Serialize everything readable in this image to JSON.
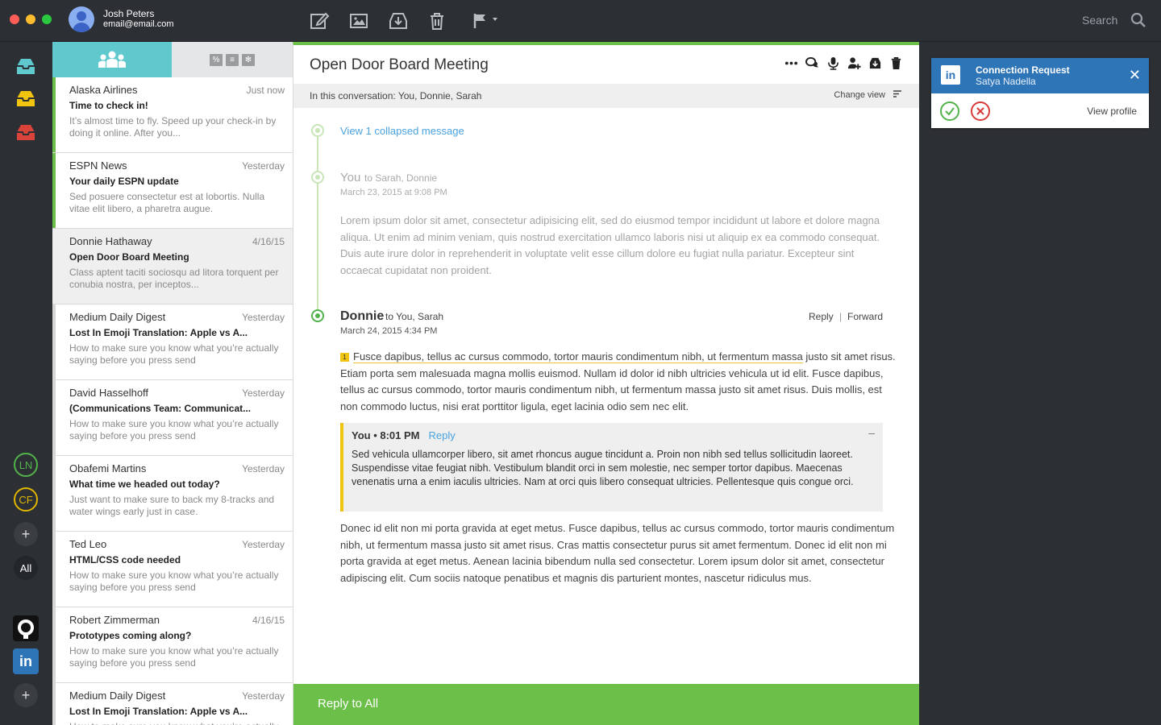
{
  "user": {
    "name": "Josh Peters",
    "email": "email@email.com"
  },
  "search": {
    "label": "Search"
  },
  "accounts": [
    {
      "label": "LN",
      "color": "#52b24b"
    },
    {
      "label": "CF",
      "color": "#e0b500"
    },
    {
      "label": "+"
    },
    {
      "label": "All"
    }
  ],
  "apps": {
    "add_label": "+",
    "linkedin_label": "in"
  },
  "list": {
    "filters": [
      "%",
      "≡",
      "✻"
    ],
    "messages": [
      {
        "sender": "Alaska Airlines",
        "date": "Just now",
        "subject": "Time to check in!",
        "preview": "It’s almost time to fly. Speed up your check-in by doing it online. After you...",
        "state": "unread"
      },
      {
        "sender": "ESPN News",
        "date": "Yesterday",
        "subject": "Your daily ESPN update",
        "preview": "Sed posuere consectetur est at lobortis. Nulla vitae elit libero, a pharetra augue.",
        "state": "unread"
      },
      {
        "sender": "Donnie Hathaway",
        "date": "4/16/15",
        "subject": "Open Door Board Meeting",
        "preview": "Class aptent taciti sociosqu ad litora torquent per conubia nostra, per inceptos...",
        "state": "selected"
      },
      {
        "sender": "Medium Daily Digest",
        "date": "Yesterday",
        "subject": "Lost In Emoji Translation: Apple vs A...",
        "preview": "How to make sure you know what you’re actually saying before you press send",
        "state": "read"
      },
      {
        "sender": "David Hasselhoff",
        "date": "Yesterday",
        "subject": "(Communications Team: Communicat...",
        "preview": "How to make sure you know what you’re actually saying before you press send",
        "state": "read"
      },
      {
        "sender": "Obafemi Martins",
        "date": "Yesterday",
        "subject": "What time we headed out today?",
        "preview": "Just want to make sure to back my 8-tracks and water wings early just in case.",
        "state": "read"
      },
      {
        "sender": "Ted Leo",
        "date": "Yesterday",
        "subject": "HTML/CSS code needed",
        "preview": "How to make sure you know what you’re actually saying before you press send",
        "state": "read"
      },
      {
        "sender": "Robert Zimmerman",
        "date": "4/16/15",
        "subject": "Prototypes coming along?",
        "preview": "How to make sure you know what you’re actually saying before you press send",
        "state": "read"
      },
      {
        "sender": "Medium Daily Digest",
        "date": "Yesterday",
        "subject": "Lost In Emoji Translation: Apple vs A...",
        "preview": "How to make sure you know what you’re actually saying before you press send",
        "state": "read"
      }
    ]
  },
  "conversation": {
    "title": "Open Door Board Meeting",
    "participants": "In this conversation: You, Donnie, Sarah",
    "change_view": "Change view",
    "collapsed_link": "View 1 collapsed message",
    "message1": {
      "from": "You",
      "to": "to Sarah, Donnie",
      "date": "March 23, 2015 at 9:08 PM",
      "body": "Lorem ipsum dolor sit amet, consectetur adipisicing elit, sed do eiusmod tempor incididunt ut labore et dolore magna aliqua. Ut enim ad minim veniam, quis nostrud exercitation ullamco laboris nisi ut aliquip ex ea commodo consequat. Duis aute irure dolor in reprehenderit in voluptate velit esse cillum dolore eu fugiat nulla pariatur. Excepteur sint occaecat cupidatat non proident."
    },
    "message2": {
      "from": "Donnie",
      "to": "to You, Sarah",
      "date": "March 24, 2015 4:34 PM",
      "reply": "Reply",
      "separator": "|",
      "forward": "Forward",
      "note_badge": "1",
      "highlight": "Fusce dapibus, tellus ac cursus commodo, tortor mauris condimentum nibh, ut fermentum massa",
      "body1_rest": " justo sit amet risus. Etiam porta sem malesuada magna mollis euismod. Nullam id dolor id nibh ultricies vehicula ut id elit. Fusce dapibus, tellus ac cursus commodo, tortor mauris condimentum nibh, ut fermentum massa justo sit amet risus. Duis mollis, est non commodo luctus, nisi erat porttitor ligula, eget lacinia odio sem nec elit.",
      "quote": {
        "header": "You • 8:01 PM",
        "reply": "Reply",
        "collapse": "–",
        "body": "Sed vehicula ullamcorper libero, sit amet rhoncus augue tincidunt a. Proin non nibh sed tellus sollicitudin laoreet. Suspendisse vitae feugiat nibh. Vestibulum blandit orci in sem molestie, nec semper tortor dapibus. Maecenas venenatis urna a enim iaculis ultricies. Nam at orci quis libero consequat ultricies. Pellentesque quis congue orci."
      },
      "body2": "Donec id elit non mi porta gravida at eget metus. Fusce dapibus, tellus ac cursus commodo, tortor mauris condimentum nibh, ut fermentum massa justo sit amet risus. Cras mattis consectetur purus sit amet fermentum. Donec id elit non mi porta gravida at eget metus. Aenean lacinia bibendum nulla sed consectetur. Lorem ipsum dolor sit amet, consectetur adipiscing elit. Cum sociis natoque penatibus et magnis dis parturient montes, nascetur ridiculus mus."
    },
    "reply_all": "Reply to All"
  },
  "notification": {
    "logo": "in",
    "title": "Connection Request",
    "subtitle": "Satya Nadella",
    "close": "✕",
    "view_profile": "View profile"
  },
  "colors": {
    "accent_green": "#6cc04a",
    "teal": "#5fc9ce",
    "linkedin_blue": "#2e75b8",
    "link_blue": "#4aa3df",
    "highlight_yellow": "#f1c40f"
  }
}
